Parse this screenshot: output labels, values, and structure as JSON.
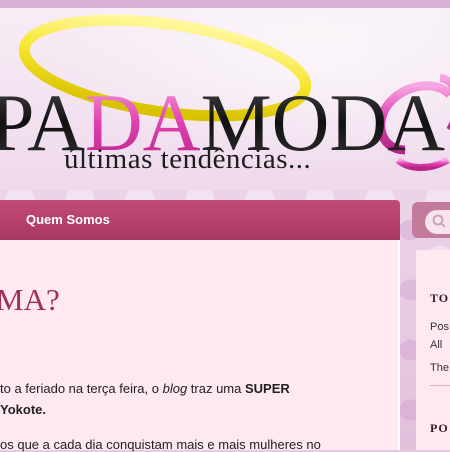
{
  "header": {
    "logo_text": [
      "PA",
      "DA",
      "MODA"
    ],
    "tagline": "últimas tendências..."
  },
  "nav": {
    "items": [
      {
        "label": "Quem Somos"
      }
    ]
  },
  "post": {
    "title": "MA?",
    "paragraphs": [
      {
        "parts": [
          "to a feriado na terça feira, o ",
          "blog",
          " traz uma ",
          "SUPER"
        ]
      },
      {
        "text": "Yokote."
      },
      {
        "text": "os que a cada dia conquistam mais e mais mulheres no"
      }
    ]
  },
  "sidebar": {
    "heading1": "TO",
    "lines": [
      "Pos",
      "All",
      "The"
    ],
    "heading2": "PO"
  },
  "colors": {
    "nav": "#b2406b",
    "title": "#a0305a",
    "content_bg": "#fde9ef",
    "logo_pink": "#e04ab0",
    "halo_yellow": "#f5e32a"
  }
}
